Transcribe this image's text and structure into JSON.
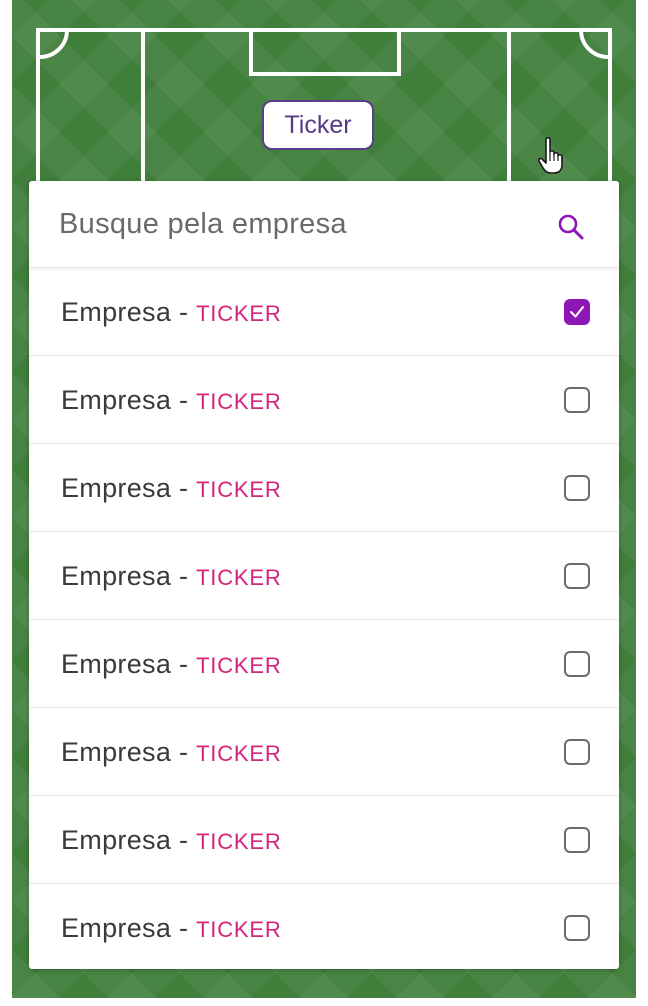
{
  "ticker_chip": {
    "label": "Ticker"
  },
  "search": {
    "placeholder": "Busque pela empresa"
  },
  "colors": {
    "field_green": "#3f7e3b",
    "accent_purple": "#8f16b6",
    "ticker_pink": "#d4237a",
    "chip_border": "#5a3d8a"
  },
  "rows": [
    {
      "name": "Empresa",
      "separator": "-",
      "ticker": "TICKER",
      "checked": true
    },
    {
      "name": "Empresa",
      "separator": "-",
      "ticker": "TICKER",
      "checked": false
    },
    {
      "name": "Empresa",
      "separator": "-",
      "ticker": "TICKER",
      "checked": false
    },
    {
      "name": "Empresa",
      "separator": "-",
      "ticker": "TICKER",
      "checked": false
    },
    {
      "name": "Empresa",
      "separator": "-",
      "ticker": "TICKER",
      "checked": false
    },
    {
      "name": "Empresa",
      "separator": "-",
      "ticker": "TICKER",
      "checked": false
    },
    {
      "name": "Empresa",
      "separator": "-",
      "ticker": "TICKER",
      "checked": false
    },
    {
      "name": "Empresa",
      "separator": "-",
      "ticker": "TICKER",
      "checked": false
    }
  ],
  "icons": {
    "search": "search-icon",
    "checkmark": "checkmark-icon",
    "cursor": "hand-pointer-cursor"
  }
}
